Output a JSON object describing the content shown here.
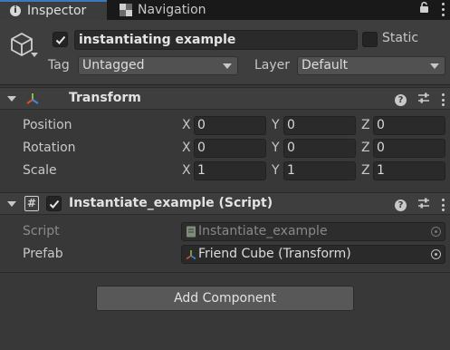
{
  "tabs": {
    "inspector_label": "Inspector",
    "navigation_label": "Navigation"
  },
  "object": {
    "active": true,
    "name": "instantiating example",
    "static_label": "Static",
    "static": false,
    "tag_label": "Tag",
    "tag_value": "Untagged",
    "layer_label": "Layer",
    "layer_value": "Default"
  },
  "transform": {
    "title": "Transform",
    "rows": [
      {
        "label": "Position",
        "x": "0",
        "y": "0",
        "z": "0"
      },
      {
        "label": "Rotation",
        "x": "0",
        "y": "0",
        "z": "0"
      },
      {
        "label": "Scale",
        "x": "1",
        "y": "1",
        "z": "1"
      }
    ],
    "axis_x": "X",
    "axis_y": "Y",
    "axis_z": "Z"
  },
  "script_component": {
    "enabled": true,
    "title": "Instantiate_example (Script)",
    "script_label": "Script",
    "script_value": "Instantiate_example",
    "prefab_label": "Prefab",
    "prefab_value": "Friend Cube (Transform)"
  },
  "add_component_label": "Add Component",
  "colors": {
    "panel_bg": "#383838",
    "tab_accent": "#3a79bb",
    "axis_x": "#e0483a",
    "axis_y": "#7fc13f",
    "axis_z": "#3e8be0"
  },
  "icons": [
    "info-icon",
    "navigation-icon",
    "lock-icon",
    "menu-icon",
    "cube-icon",
    "transform-icon",
    "help-icon",
    "presets-icon",
    "kebab-icon",
    "script-icon",
    "object-picker-icon"
  ]
}
